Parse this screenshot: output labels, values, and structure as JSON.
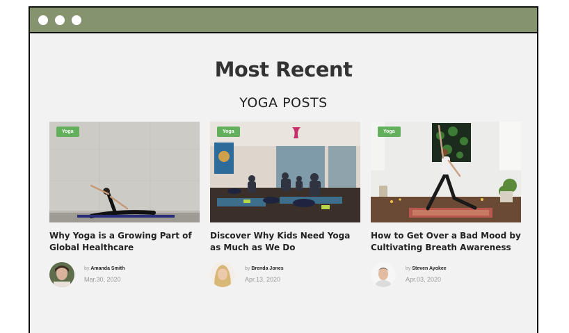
{
  "window": {
    "controls": [
      "dot",
      "dot",
      "dot"
    ]
  },
  "section": {
    "heading": "Most Recent",
    "subheading": "YOGA POSTS"
  },
  "posts": [
    {
      "tag": "Yoga",
      "title": "Why Yoga is a Growing Part of Global Healthcare",
      "by": "by",
      "author": "Amanda Smith",
      "date": "Mar.30, 2020"
    },
    {
      "tag": "Yoga",
      "title": "Discover Why Kids Need Yoga as Much as We Do",
      "by": "by",
      "author": "Brenda Jones",
      "date": "Apr.13, 2020"
    },
    {
      "tag": "Yoga",
      "title": "How to Get Over a Bad Mood by Cultivating Breath Awareness",
      "by": "by",
      "author": "Steven Ayokee",
      "date": "Apr.03, 2020"
    }
  ],
  "colors": {
    "titlebar": "#85936f",
    "tag": "#62b05b",
    "background": "#f2f2f2"
  }
}
